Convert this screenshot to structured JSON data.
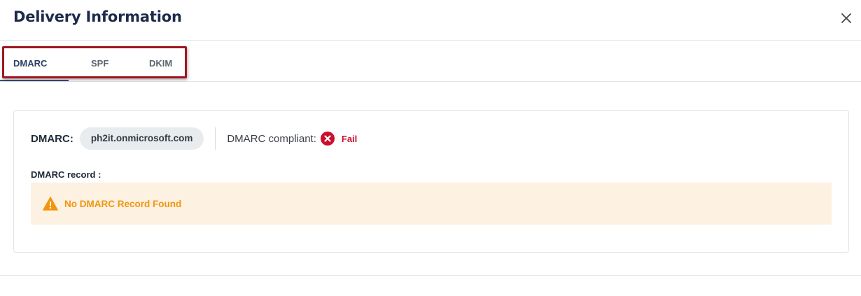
{
  "dialog": {
    "title": "Delivery Information",
    "close_icon": "close-icon"
  },
  "tabs": [
    {
      "label": "DMARC",
      "active": true
    },
    {
      "label": "SPF",
      "active": false
    },
    {
      "label": "DKIM",
      "active": false
    }
  ],
  "dmarc": {
    "label": "DMARC:",
    "domain": "ph2it.onmicrosoft.com",
    "compliant_label": "DMARC compliant:",
    "status_icon": "x-circle-icon",
    "status": "Fail",
    "record_label": "DMARC record :",
    "alert_icon": "warning-triangle-icon",
    "alert_text": "No DMARC Record Found"
  },
  "colors": {
    "title": "#1c2b4a",
    "active_tab": "#2c3e63",
    "highlight_border": "#a0161f",
    "fail": "#c8102e",
    "warning": "#f0960e",
    "alert_bg": "#fdf1e2"
  }
}
